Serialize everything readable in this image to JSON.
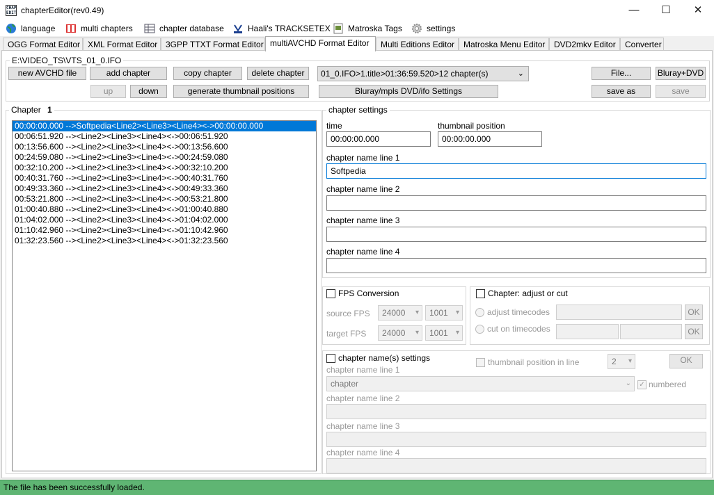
{
  "window": {
    "title": "chapterEditor(rev0.49)",
    "app_icon_text": "CHAP EDIT",
    "minimize": "—",
    "maximize": "☐",
    "close": "✕"
  },
  "menu": {
    "language": "language",
    "multi_chapters": "multi chapters",
    "chapter_database": "chapter database",
    "tracksetex": "Haali's TRACKSETEX",
    "matroska_tags": "Matroska Tags",
    "settings": "settings"
  },
  "tabs": [
    {
      "label": "OGG Format Editor"
    },
    {
      "label": "XML Format Editor"
    },
    {
      "label": "3GPP TTXT Format Editor"
    },
    {
      "label": "multiAVCHD Format Editor"
    },
    {
      "label": "Multi Editions Editor"
    },
    {
      "label": "Matroska Menu Editor"
    },
    {
      "label": "DVD2mkv Editor"
    },
    {
      "label": "Converter"
    }
  ],
  "file_path": "E:\\VIDEO_TS\\VTS_01_0.IFO",
  "toolbar": {
    "new_avchd": "new AVCHD file",
    "add_chapter": "add chapter",
    "copy_chapter": "copy chapter",
    "delete_chapter": "delete chapter",
    "up": "up",
    "down": "down",
    "generate_thumbs": "generate thumbnail positions",
    "source_select": "01_0.IFO>1.title>01:36:59.520>12 chapter(s)",
    "bluray_settings": "Bluray/mpls DVD/ifo Settings",
    "file": "File...",
    "bluray_dvd": "Bluray+DVD",
    "save_as": "save as",
    "save": "save"
  },
  "chapter_list": {
    "label": "Chapter",
    "number": "1",
    "rows": [
      "00:00:00.000 -->Softpedia<Line2><Line3><Line4><->00:00:00.000",
      "00:06:51.920 --><Line2><Line3><Line4><->00:06:51.920",
      "00:13:56.600 --><Line2><Line3><Line4><->00:13:56.600",
      "00:24:59.080 --><Line2><Line3><Line4><->00:24:59.080",
      "00:32:10.200 --><Line2><Line3><Line4><->00:32:10.200",
      "00:40:31.760 --><Line2><Line3><Line4><->00:40:31.760",
      "00:49:33.360 --><Line2><Line3><Line4><->00:49:33.360",
      "00:53:21.800 --><Line2><Line3><Line4><->00:53:21.800",
      "01:00:40.880 --><Line2><Line3><Line4><->01:00:40.880",
      "01:04:02.000 --><Line2><Line3><Line4><->01:04:02.000",
      "01:10:42.960 --><Line2><Line3><Line4><->01:10:42.960",
      "01:32:23.560 --><Line2><Line3><Line4><->01:32:23.560"
    ]
  },
  "chapter_settings": {
    "title": "chapter settings",
    "time_label": "time",
    "time_value": "00:00:00.000",
    "thumb_label": "thumbnail position",
    "thumb_value": "00:00:00.000",
    "line1_label": "chapter name line 1",
    "line1_value": "Softpedia",
    "line2_label": "chapter name line 2",
    "line2_value": "",
    "line3_label": "chapter name line 3",
    "line3_value": "",
    "line4_label": "chapter name line 4",
    "line4_value": ""
  },
  "fps": {
    "title": "FPS Conversion",
    "source_label": "source FPS",
    "source_value": "24000",
    "source_div": "1001",
    "target_label": "target FPS",
    "target_value": "24000",
    "target_div": "1001"
  },
  "adjust": {
    "title": "Chapter: adjust or cut",
    "adjust_label": "adjust timecodes",
    "cut_label": "cut on timecodes",
    "ok": "OK"
  },
  "names": {
    "title": "chapter name(s) settings",
    "thumb_in_line": "thumbnail position in line",
    "thumb_line_value": "2",
    "ok": "OK",
    "line1_label": "chapter name line 1",
    "line1_value": "chapter",
    "numbered": "numbered",
    "line2_label": "chapter name line 2",
    "line3_label": "chapter name line 3",
    "line4_label": "chapter name line 4"
  },
  "status": "The file has been successfully loaded.",
  "colors": {
    "selection": "#0078d7",
    "status_bar": "#5fb573",
    "accent_focus": "#0078d7"
  }
}
